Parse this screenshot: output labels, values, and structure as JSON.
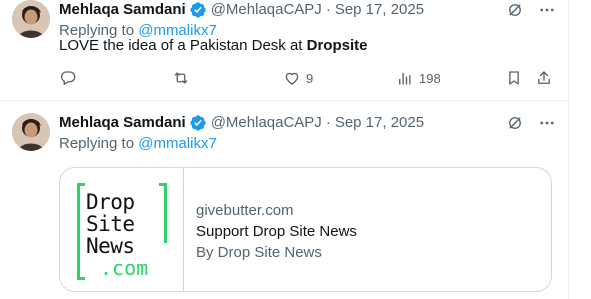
{
  "tweets": [
    {
      "author": {
        "name": "Mehlaqa Samdani",
        "handle": "@MehlaqaCAPJ",
        "date": "Sep 17, 2025",
        "avatar_icon": "profile-photo"
      },
      "replying_prefix": "Replying to ",
      "replying_to": "@mmalikx7",
      "text_plain": "LOVE the idea of a Pakistan Desk at ",
      "text_bold": "Dropsite",
      "stats": {
        "replies": "",
        "reposts": "",
        "likes": "9",
        "views": "198"
      }
    },
    {
      "author": {
        "name": "Mehlaqa Samdani",
        "handle": "@MehlaqaCAPJ",
        "date": "Sep 17, 2025",
        "avatar_icon": "profile-photo"
      },
      "replying_prefix": "Replying to ",
      "replying_to": "@mmalikx7",
      "card": {
        "logo_lines": [
          "Drop",
          "Site",
          "News"
        ],
        "logo_suffix": ".com",
        "domain": "givebutter.com",
        "title": "Support Drop Site News",
        "byline": "By Drop Site News"
      }
    }
  ],
  "separator": "·",
  "colors": {
    "verified": "#1d9bf0",
    "mention": "#1d9bf0",
    "muted": "#536471",
    "logo_green": "#2bd46b",
    "border": "#cfd9de"
  },
  "icons": [
    "verified-badge-icon",
    "grok-icon",
    "more-icon",
    "reply-icon",
    "repost-icon",
    "like-icon",
    "views-icon",
    "bookmark-icon",
    "share-icon"
  ]
}
